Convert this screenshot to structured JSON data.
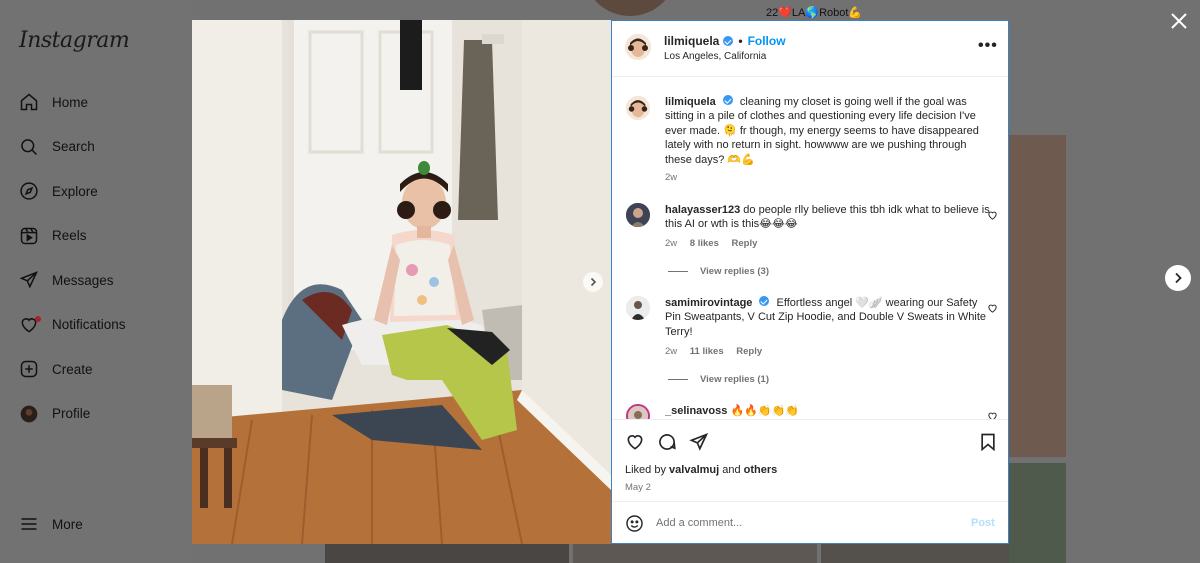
{
  "app": {
    "logo": "Instagram"
  },
  "sidebar": {
    "items": [
      {
        "label": "Home",
        "icon": "home-icon"
      },
      {
        "label": "Search",
        "icon": "search-icon"
      },
      {
        "label": "Explore",
        "icon": "compass-icon"
      },
      {
        "label": "Reels",
        "icon": "reels-icon"
      },
      {
        "label": "Messages",
        "icon": "send-icon"
      },
      {
        "label": "Notifications",
        "icon": "heart-icon"
      },
      {
        "label": "Create",
        "icon": "plus-square-icon"
      },
      {
        "label": "Profile",
        "icon": "avatar-icon"
      }
    ],
    "more": "More"
  },
  "background": {
    "bio": "22❤️LA🌎Robot💪"
  },
  "post": {
    "username": "lilmiquela",
    "follow": "Follow",
    "dot": "•",
    "location": "Los Angeles, California",
    "more": "•••",
    "caption": {
      "username": "lilmiquela",
      "text": "cleaning my closet is going well if the goal was sitting in a pile of clothes and questioning every life decision I've ever made. 🫠 fr though, my energy seems to have disappeared lately with no return in sight. howwww are we pushing through these days? 🫶💪",
      "time": "2w"
    },
    "comments": [
      {
        "username": "halayasser123",
        "text": "do people rlly believe this tbh idk what to believe is this AI or wth is this😂😂😂",
        "time": "2w",
        "likes": "8 likes",
        "reply": "Reply",
        "view_replies": "View replies (3)"
      },
      {
        "username": "samimirovintage",
        "verified": true,
        "text": "Effortless angel 🤍🪽 wearing our Safety Pin Sweatpants, V Cut Zip Hoodie, and Double V Sweats in White Terry!",
        "time": "2w",
        "likes": "11 likes",
        "reply": "Reply",
        "view_replies": "View replies (1)"
      },
      {
        "username": "_selinavoss",
        "text": "🔥🔥👏👏👏"
      }
    ],
    "liked_by_prefix": "Liked by",
    "liked_by_user": "valvalmuj",
    "liked_by_and": "and",
    "liked_by_others": "others",
    "date": "May 2",
    "add_comment_placeholder": "Add a comment...",
    "post_button": "Post",
    "carousel": {
      "slides": 4,
      "active": 1
    }
  },
  "colors": {
    "accent": "#0095f6",
    "verified": "#3897f0",
    "overlay": "#717171",
    "panel_border": "#3b82c4"
  }
}
